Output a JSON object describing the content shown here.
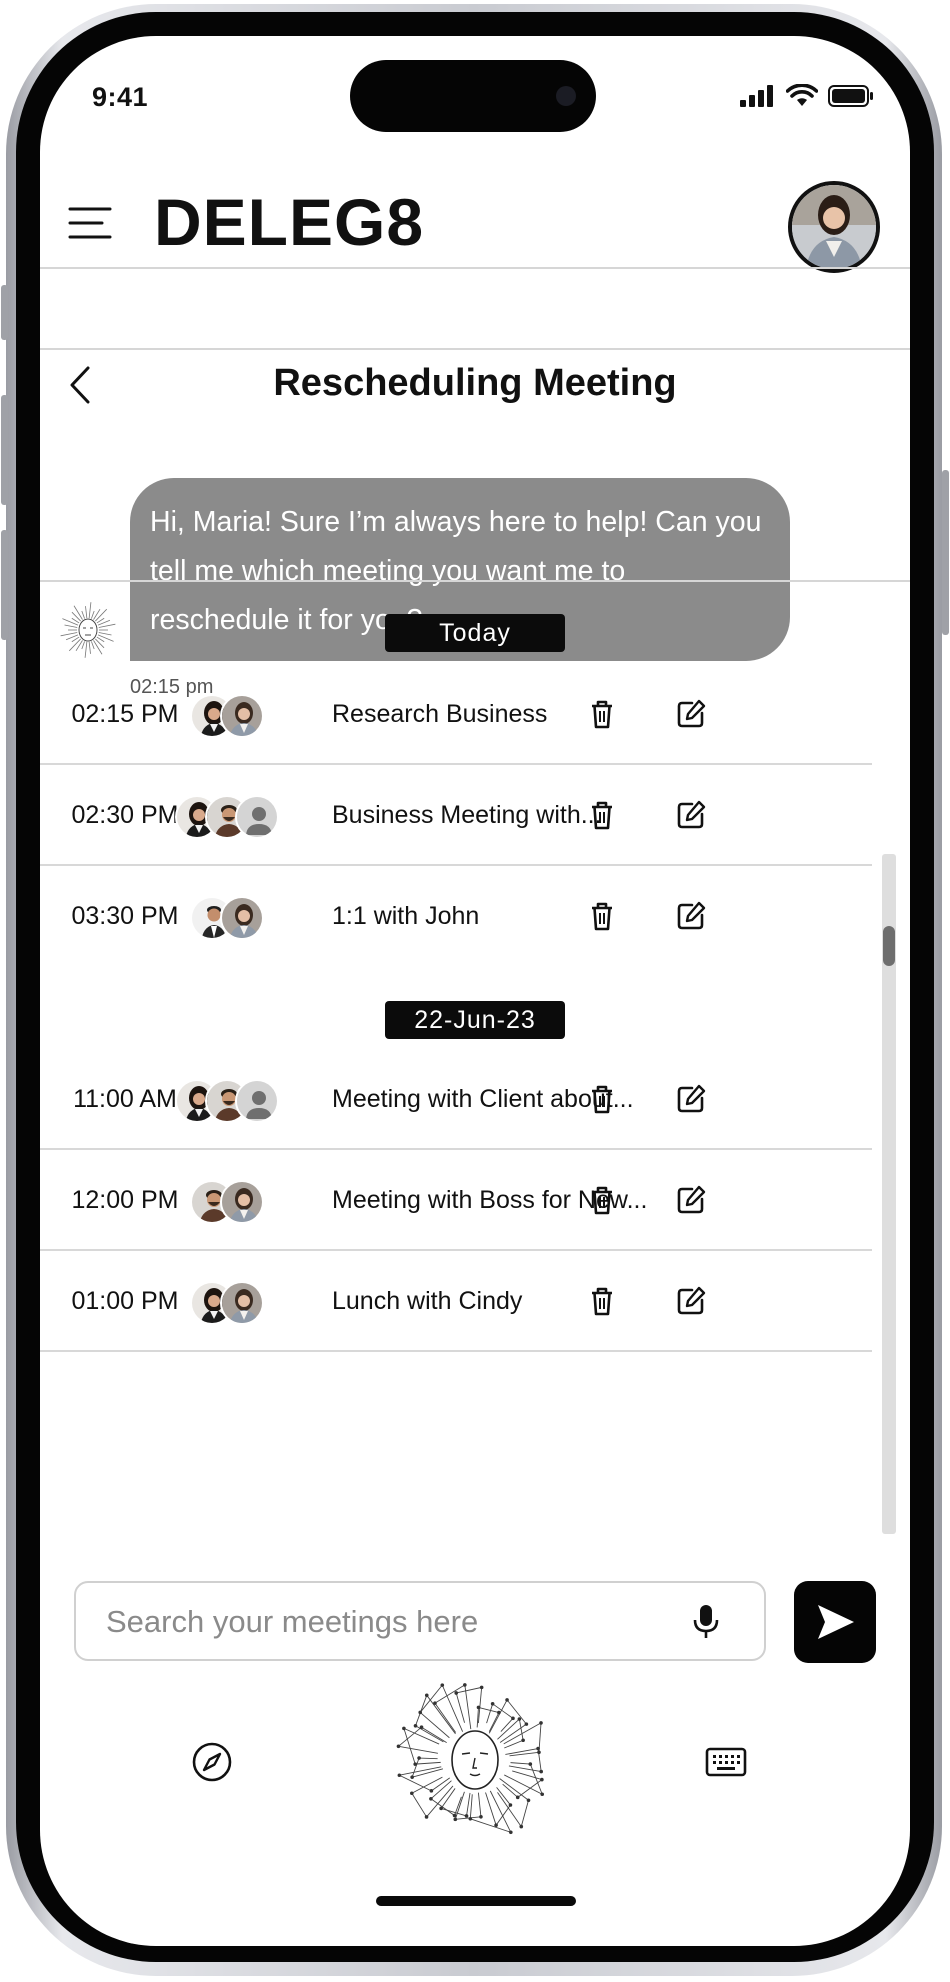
{
  "status_bar": {
    "time": "9:41"
  },
  "header": {
    "app_title": "DELEG8"
  },
  "conversation": {
    "title": "Rescheduling Meeting",
    "bot_message": "Hi, Maria! Sure I’m always here to help! Can you tell me which meeting you want me to reschedule it for you?",
    "bot_message_time": "02:15 pm"
  },
  "meetings": {
    "groups": [
      {
        "label": "Today",
        "items": [
          {
            "time": "02:15 PM",
            "title": "Research Business",
            "participants": [
              "woman-dark-hair",
              "woman-blazer"
            ]
          },
          {
            "time": "02:30 PM",
            "title": "Business Meeting with...",
            "participants": [
              "woman-dark-hair",
              "man-beard",
              "placeholder-person"
            ]
          },
          {
            "time": "03:30 PM",
            "title": "1:1 with John",
            "participants": [
              "man-suit",
              "woman-blazer"
            ]
          }
        ]
      },
      {
        "label": "22-Jun-23",
        "items": [
          {
            "time": "11:00 AM",
            "title": "Meeting with Client about...",
            "participants": [
              "woman-dark-hair",
              "man-beard",
              "placeholder-person"
            ]
          },
          {
            "time": "12:00 PM",
            "title": "Meeting with Boss for New...",
            "participants": [
              "man-beard",
              "woman-blazer"
            ]
          },
          {
            "time": "01:00 PM",
            "title": "Lunch with Cindy",
            "participants": [
              "woman-dark-hair",
              "woman-blazer"
            ]
          }
        ]
      }
    ]
  },
  "search": {
    "placeholder": "Search your meetings here"
  },
  "bottom_nav": {
    "left_icon": "compass-icon",
    "center_icon": "ai-orb-icon",
    "right_icon": "keyboard-icon"
  }
}
